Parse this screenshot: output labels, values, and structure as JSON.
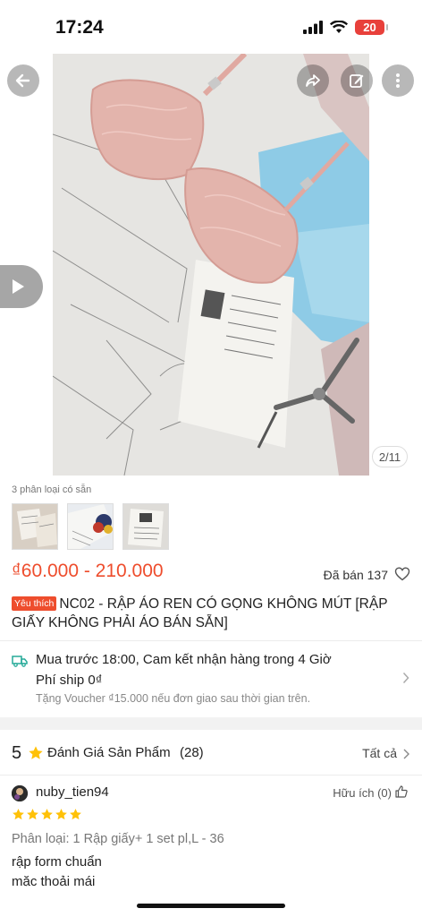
{
  "status_bar": {
    "time": "17:24",
    "battery": "20"
  },
  "gallery": {
    "image_counter": "2/11",
    "icons": [
      "back-arrow-icon",
      "share-icon",
      "edit-icon",
      "more-icon",
      "play-video-icon"
    ]
  },
  "variants": {
    "label": "3 phân loại có sẵn",
    "count": 3
  },
  "product": {
    "price": "₫60.000 - 210.000",
    "sold": "Đã bán 137",
    "badge": "Yêu thích",
    "title": "NC02 - RẬP ÁO REN CÓ GỌNG KHÔNG MÚT [RẬP GIẤY KHÔNG PHẢI ÁO BÁN SẴN]"
  },
  "shipping": {
    "main": "Mua trước 18:00, Cam kết nhận hàng trong 4 Giờ",
    "fee": "Phí ship 0₫",
    "voucher": "Tặng Voucher ₫15.000 nếu đơn giao sau thời gian trên."
  },
  "reviews": {
    "rating": "5",
    "title": "Đánh Giá Sản Phẩm",
    "count": "(28)",
    "see_all": "Tất cả",
    "items": [
      {
        "username": "nuby_tien94",
        "helpful": "Hữu ích (0)",
        "stars": 5,
        "variant": "Phân loại: 1 Rập giấy+ 1 set pl,L - 36",
        "comment_line1": "rập form chuẩn",
        "comment_line2": "mặc thoải mái"
      }
    ]
  },
  "colors": {
    "accent": "#ee4d2d",
    "star": "#ffc107",
    "ship_icon": "#26aa99"
  }
}
